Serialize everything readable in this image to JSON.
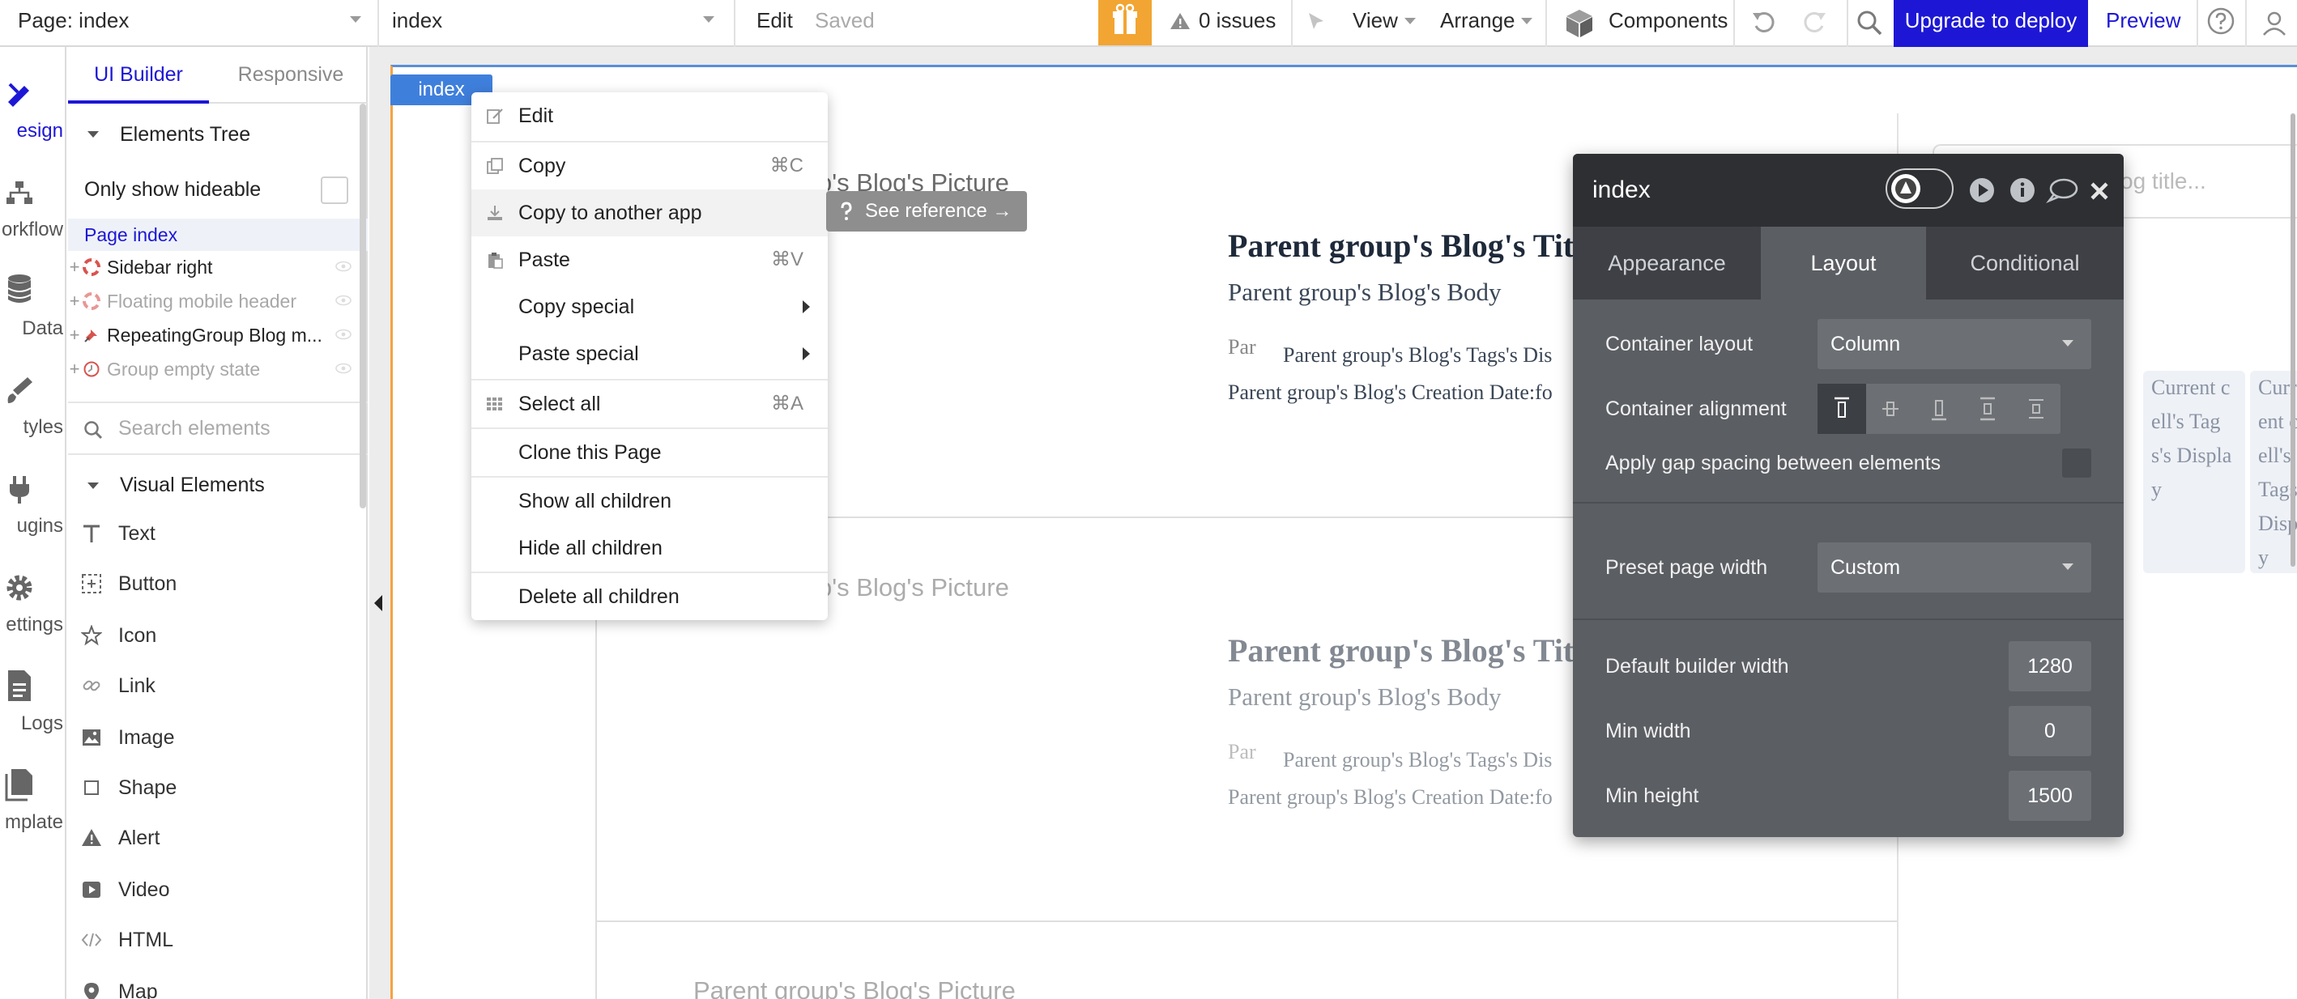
{
  "topbar": {
    "page_selector": "Page: index",
    "element_selector": "index",
    "edit": "Edit",
    "saved": "Saved",
    "issues": "0 issues",
    "view": "View",
    "arrange": "Arrange",
    "components": "Components",
    "upgrade": "Upgrade to deploy",
    "preview": "Preview",
    "upgrade_color": "#1d17d5",
    "gift_color": "#f2a532"
  },
  "rail": {
    "items": [
      {
        "label": "esign",
        "icon": "design-icon"
      },
      {
        "label": "orkflow",
        "icon": "workflow-icon"
      },
      {
        "label": "Data",
        "icon": "data-icon"
      },
      {
        "label": "tyles",
        "icon": "styles-icon"
      },
      {
        "label": "ugins",
        "icon": "plugins-icon"
      },
      {
        "label": "ettings",
        "icon": "settings-icon"
      },
      {
        "label": "Logs",
        "icon": "logs-icon"
      },
      {
        "label": "mplate",
        "icon": "template-icon"
      }
    ]
  },
  "panel": {
    "tabs": [
      "UI Builder",
      "Responsive"
    ],
    "elements_tree": "Elements Tree",
    "only_hideable": "Only show hideable",
    "page_item": "Page index",
    "tree": [
      {
        "label": "Sidebar right",
        "faded": false,
        "icon": "lifebuoy-icon"
      },
      {
        "label": "Floating mobile header",
        "faded": true,
        "icon": "lifebuoy-icon"
      },
      {
        "label": "RepeatingGroup Blog m...",
        "faded": false,
        "icon": "pin-icon"
      },
      {
        "label": "Group empty state",
        "faded": true,
        "icon": "clock-icon"
      }
    ],
    "search_placeholder": "Search elements",
    "visual_elements": "Visual Elements",
    "visual": [
      {
        "label": "Text",
        "icon": "text-icon"
      },
      {
        "label": "Button",
        "icon": "button-icon"
      },
      {
        "label": "Icon",
        "icon": "star-icon"
      },
      {
        "label": "Link",
        "icon": "link-icon"
      },
      {
        "label": "Image",
        "icon": "image-icon"
      },
      {
        "label": "Shape",
        "icon": "shape-icon"
      },
      {
        "label": "Alert",
        "icon": "alert-icon"
      },
      {
        "label": "Video",
        "icon": "video-icon"
      },
      {
        "label": "HTML",
        "icon": "html-icon"
      },
      {
        "label": "Map",
        "icon": "map-pin-icon"
      }
    ]
  },
  "canvas": {
    "page_label": "index",
    "cells": [
      {
        "picture": "p's Blog's Picture",
        "title": "Parent group's Blog's Tit",
        "body": "Parent group's Blog's Body",
        "tags": "Parent group's Blog's Tags's Dis",
        "avatar": "Par",
        "date": "Parent group's Blog's Creation Date:fo"
      },
      {
        "picture": "p's Blog's Picture",
        "title": "Parent group's Blog's Tit",
        "body": "Parent group's Blog's Body",
        "tags": "Parent group's Blog's Tags's Dis",
        "avatar": "Par",
        "date": "Parent group's Blog's Creation Date:fo"
      },
      {
        "picture": "Parent group's Blog's Picture"
      }
    ],
    "search_placeholder": "og title...",
    "tag_boxes": [
      "Current cell's Tags's Display",
      "Current cell's Tags Disp y"
    ]
  },
  "context_menu": {
    "items": [
      {
        "label": "Edit",
        "key": "",
        "icon": "edit-icon"
      },
      {
        "label": "Copy",
        "key": "⌘C",
        "icon": "copy-icon"
      },
      {
        "label": "Copy to another app",
        "key": "",
        "icon": "download-icon"
      },
      {
        "label": "Paste",
        "key": "⌘V",
        "icon": "paste-icon"
      },
      {
        "label": "Copy special",
        "key": "",
        "icon": ""
      },
      {
        "label": "Paste special",
        "key": "",
        "icon": ""
      },
      {
        "label": "Select all",
        "key": "⌘A",
        "icon": "grid-icon"
      },
      {
        "label": "Clone this Page",
        "key": "",
        "icon": ""
      },
      {
        "label": "Show all children",
        "key": "",
        "icon": ""
      },
      {
        "label": "Hide all children",
        "key": "",
        "icon": ""
      },
      {
        "label": "Delete all children",
        "key": "",
        "icon": ""
      }
    ],
    "see_reference": "See reference →"
  },
  "property_editor": {
    "title": "index",
    "tabs": [
      "Appearance",
      "Layout",
      "Conditional"
    ],
    "active_tab": "Layout",
    "container_layout_label": "Container layout",
    "container_layout_value": "Column",
    "container_alignment_label": "Container alignment",
    "gap_label": "Apply gap spacing between elements",
    "preset_label": "Preset page width",
    "preset_value": "Custom",
    "default_width_label": "Default builder width",
    "default_width_value": "1280",
    "min_width_label": "Min width",
    "min_width_value": "0",
    "min_height_label": "Min height",
    "min_height_value": "1500"
  }
}
